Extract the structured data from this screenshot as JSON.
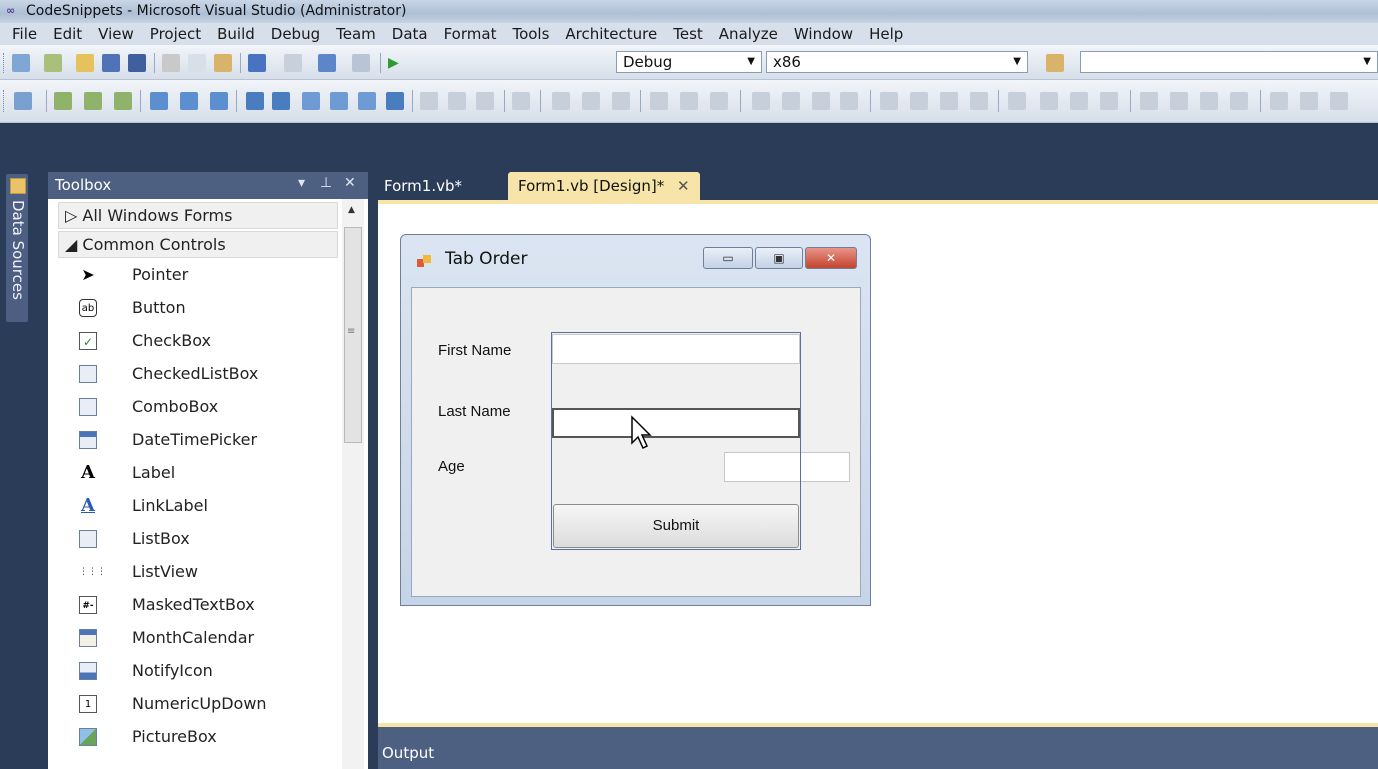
{
  "window": {
    "title": "CodeSnippets - Microsoft Visual Studio (Administrator)"
  },
  "menu": [
    "File",
    "Edit",
    "View",
    "Project",
    "Build",
    "Debug",
    "Team",
    "Data",
    "Format",
    "Tools",
    "Architecture",
    "Test",
    "Analyze",
    "Window",
    "Help"
  ],
  "toolbar": {
    "config": "Debug",
    "platform": "x86",
    "find": ""
  },
  "side_tab": {
    "label": "Data Sources"
  },
  "toolbox": {
    "title": "Toolbox",
    "pin_glyph": "▾ ⊥ ✕",
    "categories": [
      {
        "label": "▷ All Windows Forms"
      },
      {
        "label": "◢ Common Controls"
      }
    ],
    "items": [
      {
        "label": "Pointer",
        "icon": "pointer-icon"
      },
      {
        "label": "Button",
        "icon": "button-icon",
        "glyph": "ab"
      },
      {
        "label": "CheckBox",
        "icon": "checkbox-icon",
        "glyph": "✓"
      },
      {
        "label": "CheckedListBox",
        "icon": "checkedlistbox-icon"
      },
      {
        "label": "ComboBox",
        "icon": "combobox-icon"
      },
      {
        "label": "DateTimePicker",
        "icon": "datetimepicker-icon"
      },
      {
        "label": "Label",
        "icon": "label-icon",
        "glyph": "A"
      },
      {
        "label": "LinkLabel",
        "icon": "linklabel-icon",
        "glyph": "A"
      },
      {
        "label": "ListBox",
        "icon": "listbox-icon"
      },
      {
        "label": "ListView",
        "icon": "listview-icon"
      },
      {
        "label": "MaskedTextBox",
        "icon": "maskedtextbox-icon",
        "glyph": "#-"
      },
      {
        "label": "MonthCalendar",
        "icon": "monthcalendar-icon"
      },
      {
        "label": "NotifyIcon",
        "icon": "notifyicon-icon"
      },
      {
        "label": "NumericUpDown",
        "icon": "numericupdown-icon",
        "glyph": "1"
      },
      {
        "label": "PictureBox",
        "icon": "picturebox-icon"
      }
    ]
  },
  "tabs": [
    {
      "label": "Form1.vb*",
      "active": false
    },
    {
      "label": "Form1.vb [Design]*",
      "active": true,
      "close": "✕"
    }
  ],
  "form": {
    "title": "Tab Order",
    "controls": {
      "first_name_label": "First Name",
      "last_name_label": "Last Name",
      "age_label": "Age",
      "submit_label": "Submit"
    }
  },
  "output": {
    "title": "Output"
  },
  "colors": {
    "chrome": "#2b3c59",
    "panel_header": "#4d6082",
    "active_tab": "#f6e4a8"
  }
}
